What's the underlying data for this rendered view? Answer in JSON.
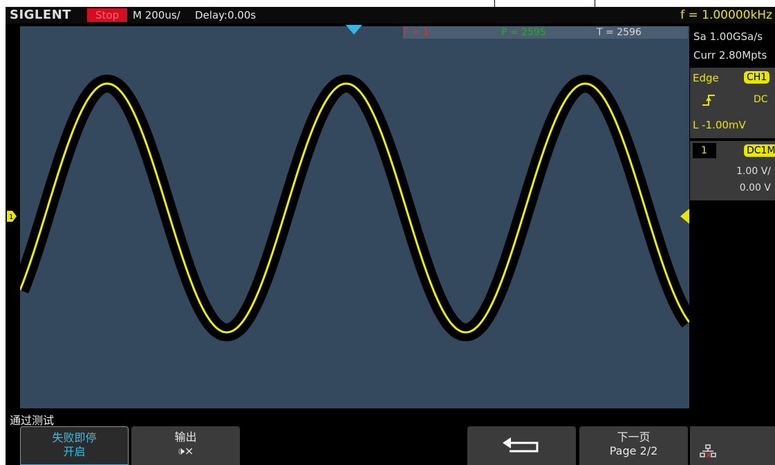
{
  "header": {
    "brand": "SIGLENT",
    "run_state": "Stop",
    "timebase": "M 200us/",
    "delay": "Delay:0.00s",
    "frequency": "f = 1.00000kHz"
  },
  "stats": {
    "fail": "F = 1",
    "pass": "P = 2595",
    "total": "T = 2596"
  },
  "channel_marker": "1",
  "side_panel": {
    "sample_rate": "Sa 1.00GSa/s",
    "memory": "Curr 2.80Mpts",
    "trigger": {
      "type": "Edge",
      "source": "CH1",
      "slope_icon": "rising-edge-icon",
      "coupling": "DC",
      "level": "L  -1.00mV"
    },
    "channel": {
      "number": "1",
      "coupling": "DC1M",
      "scale": "1.00 V/",
      "offset": "0.00 V"
    }
  },
  "menu": {
    "title": "通过测试",
    "softkeys": [
      {
        "line1": "失败即停",
        "line2": "开启"
      },
      {
        "line1": "输出",
        "line2": "🕩×"
      },
      {
        "icon": "return-arrow-icon"
      },
      {
        "line1": "下一页",
        "line2": "Page 2/2"
      }
    ],
    "network_icon": "network-icon"
  },
  "colors": {
    "grid_bg": "#34495e",
    "trace": "#f0f000",
    "trace_mask": "#000000",
    "accent": "#38bde8",
    "run_state_bg": "#d01020"
  },
  "waveform": {
    "type": "sine",
    "frequency_hz": 1000,
    "timebase_per_div": "200us",
    "volts_per_div": 1.0,
    "cycles_on_screen": 2.8
  }
}
